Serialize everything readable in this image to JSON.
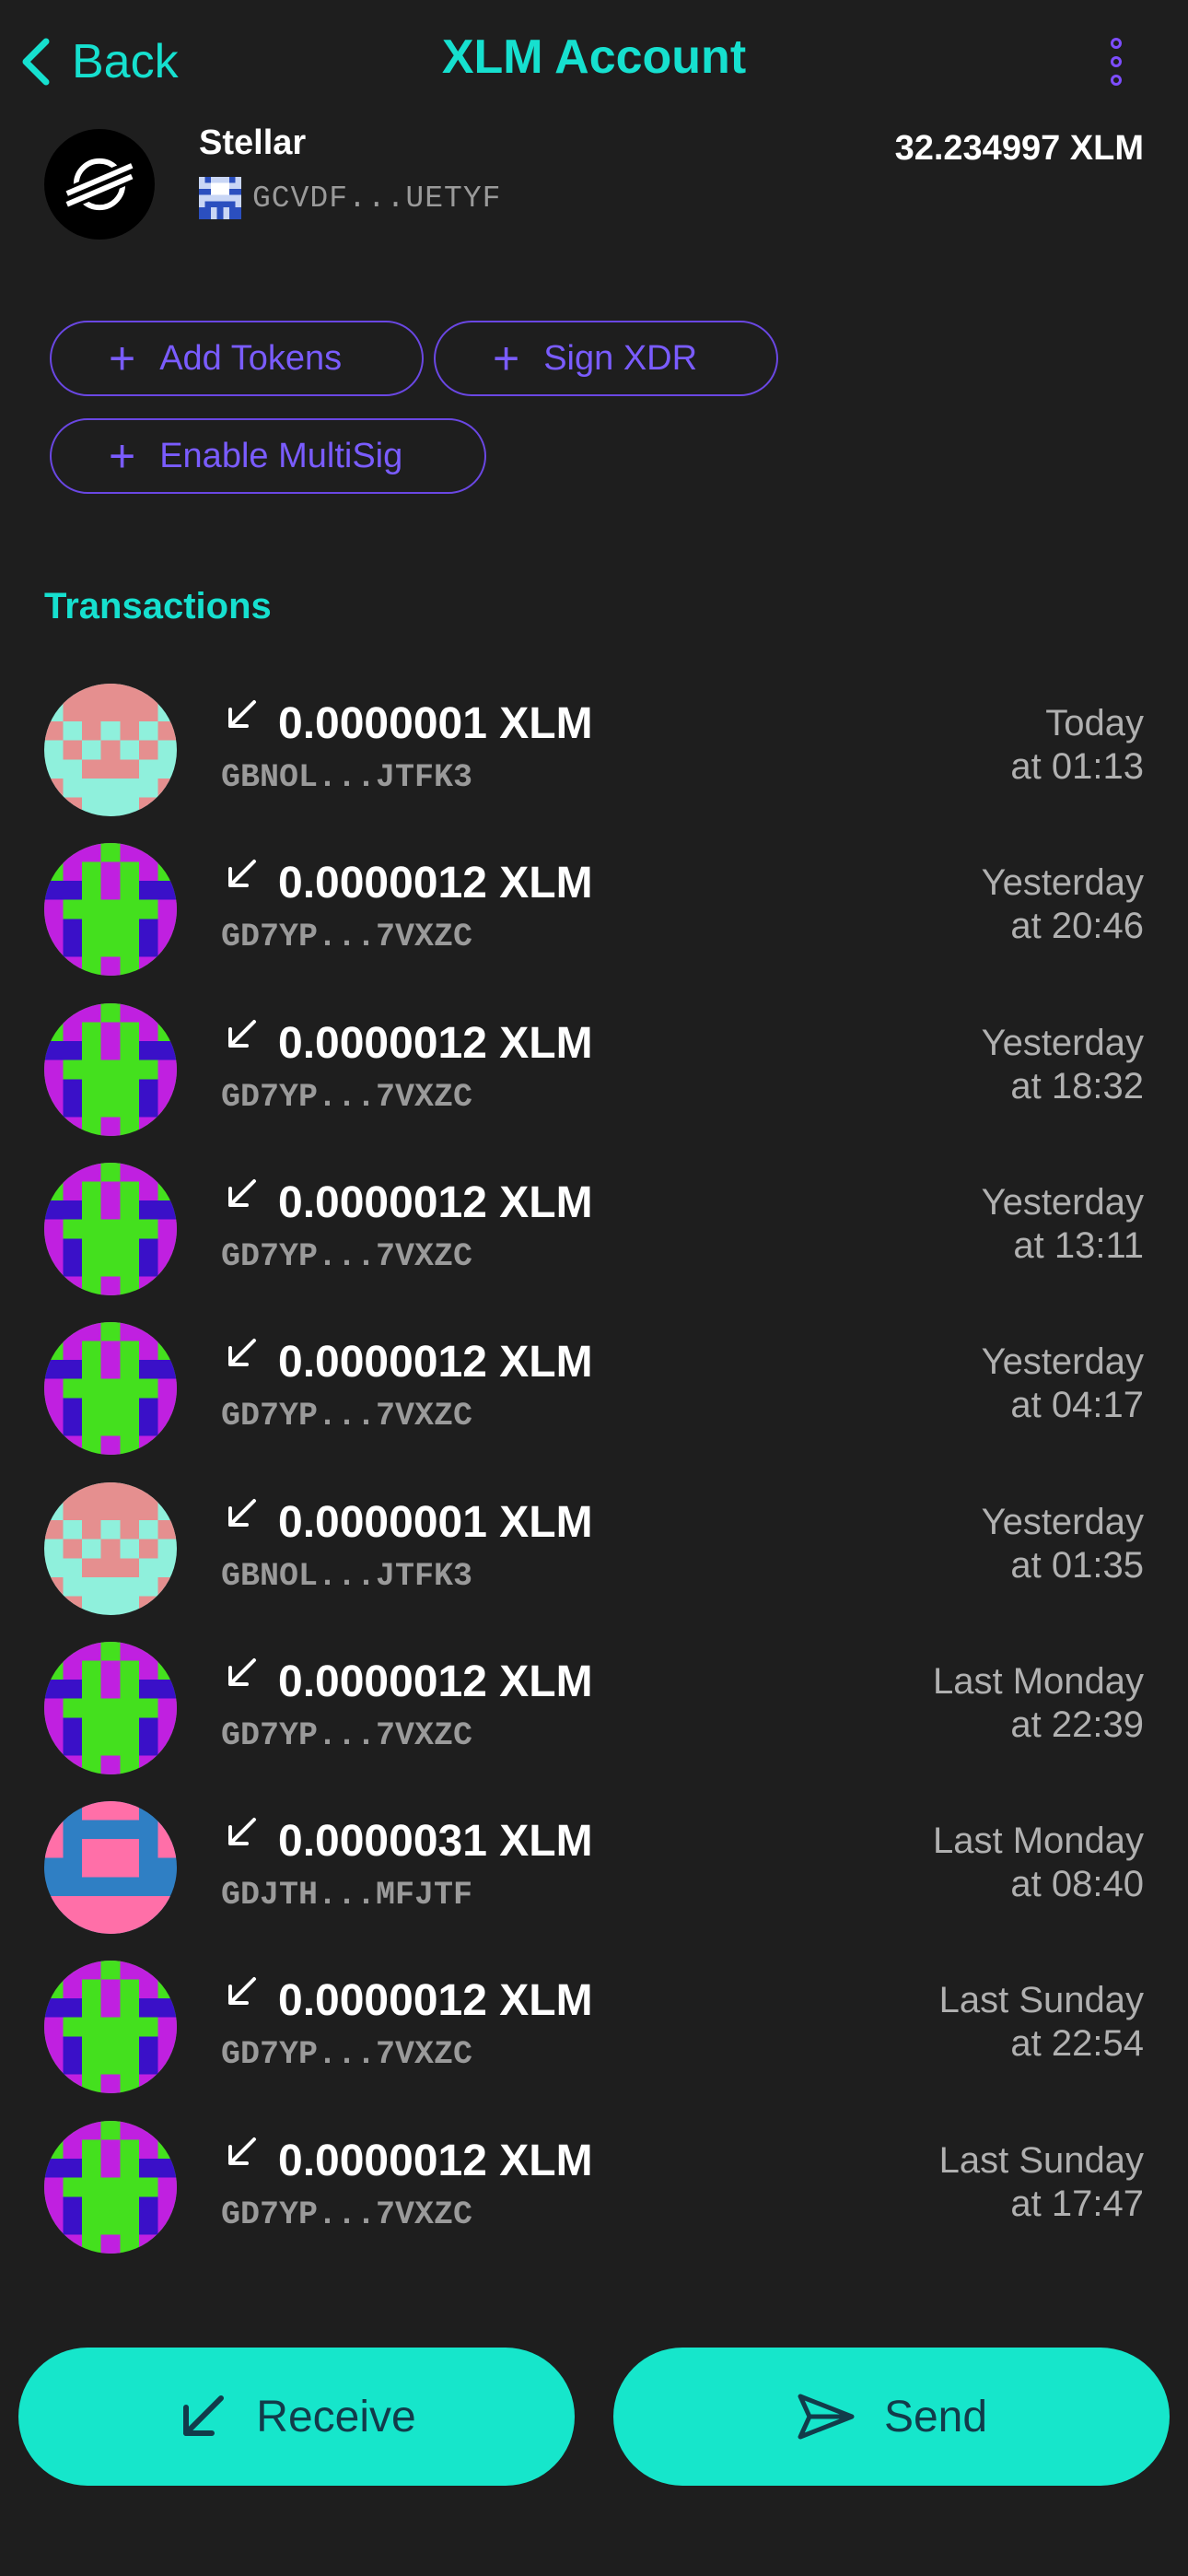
{
  "header": {
    "back_label": "Back",
    "title": "XLM Account",
    "back_icon": "chevron-left-icon",
    "menu_icon": "more-vertical-icon"
  },
  "account": {
    "name": "Stellar",
    "address": "GCVDF...UETYF",
    "balance": "32.234997 XLM"
  },
  "actions": {
    "add_tokens": "Add Tokens",
    "sign_xdr": "Sign XDR",
    "enable_multisig": "Enable MultiSig"
  },
  "transactions_title": "Transactions",
  "transactions": [
    {
      "amount": "0.0000001 XLM",
      "address": "GBNOL...JTFK3",
      "when_day": "Today",
      "when_time": "at 01:13",
      "avatar": "a"
    },
    {
      "amount": "0.0000012 XLM",
      "address": "GD7YP...7VXZC",
      "when_day": "Yesterday",
      "when_time": "at 20:46",
      "avatar": "b"
    },
    {
      "amount": "0.0000012 XLM",
      "address": "GD7YP...7VXZC",
      "when_day": "Yesterday",
      "when_time": "at 18:32",
      "avatar": "b"
    },
    {
      "amount": "0.0000012 XLM",
      "address": "GD7YP...7VXZC",
      "when_day": "Yesterday",
      "when_time": "at 13:11",
      "avatar": "b"
    },
    {
      "amount": "0.0000012 XLM",
      "address": "GD7YP...7VXZC",
      "when_day": "Yesterday",
      "when_time": "at 04:17",
      "avatar": "b"
    },
    {
      "amount": "0.0000001 XLM",
      "address": "GBNOL...JTFK3",
      "when_day": "Yesterday",
      "when_time": "at 01:35",
      "avatar": "a"
    },
    {
      "amount": "0.0000012 XLM",
      "address": "GD7YP...7VXZC",
      "when_day": "Last Monday",
      "when_time": "at 22:39",
      "avatar": "b"
    },
    {
      "amount": "0.0000031 XLM",
      "address": "GDJTH...MFJTF",
      "when_day": "Last Monday",
      "when_time": "at 08:40",
      "avatar": "c"
    },
    {
      "amount": "0.0000012 XLM",
      "address": "GD7YP...7VXZC",
      "when_day": "Last Sunday",
      "when_time": "at 22:54",
      "avatar": "b"
    },
    {
      "amount": "0.0000012 XLM",
      "address": "GD7YP...7VXZC",
      "when_day": "Last Sunday",
      "when_time": "at 17:47",
      "avatar": "b"
    }
  ],
  "footer": {
    "receive_label": "Receive",
    "send_label": "Send"
  },
  "colors": {
    "background": "#1e1e1e",
    "accent": "#16e0cf",
    "purple": "#7a5cff",
    "button": "#16e6cb"
  }
}
